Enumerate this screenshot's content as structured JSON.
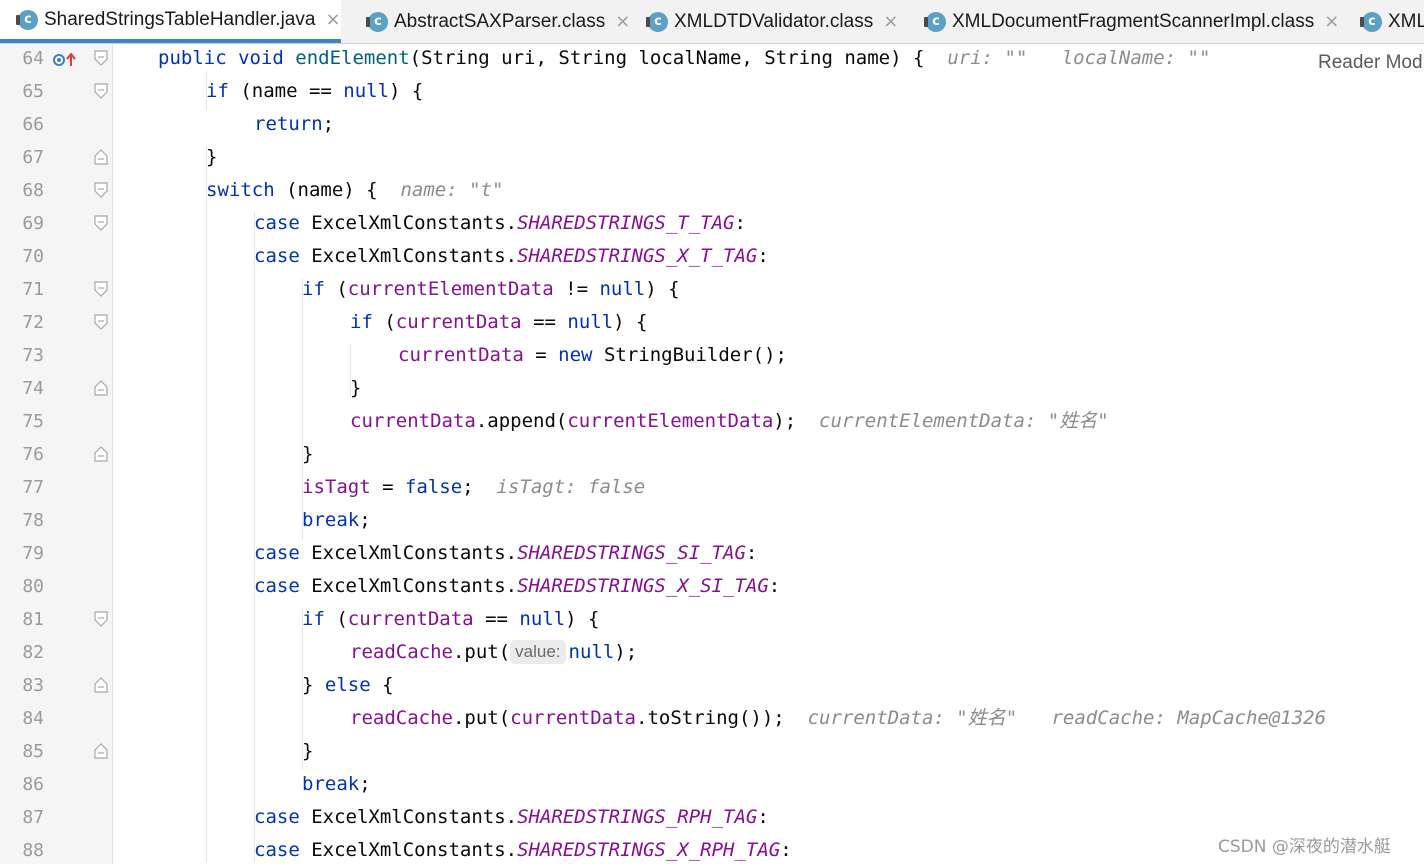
{
  "tabs": [
    {
      "label": "SharedStringsTableHandler.java",
      "active": true
    },
    {
      "label": "AbstractSAXParser.class",
      "active": false
    },
    {
      "label": "XMLDTDValidator.class",
      "active": false
    },
    {
      "label": "XMLDocumentFragmentScannerImpl.class",
      "active": false
    },
    {
      "label": "XML",
      "active": false
    }
  ],
  "icons": {
    "tab_icon": "class-c-icon",
    "close": "close-icon",
    "breakpoint": "override-up-arrow-icon",
    "fold": "fold-marker-icon"
  },
  "reader_mode": "Reader Mod",
  "watermark": "CSDN @深夜的潜水艇",
  "colors": {
    "keyword": "#0033b3",
    "field": "#871094",
    "method": "#00627a",
    "hint": "#8c8c8c",
    "tab_accent": "#4083c9"
  },
  "lines": [
    {
      "num": "64",
      "indent": 0,
      "segs": [
        [
          "kw",
          "public void "
        ],
        [
          "fn",
          "endElement"
        ],
        [
          "",
          "(String uri, String localName, String name) {  "
        ],
        [
          "hint",
          "uri: \"\"   localName: \"\""
        ]
      ]
    },
    {
      "num": "65",
      "indent": 1,
      "segs": [
        [
          "kw",
          "if"
        ],
        [
          "",
          " (name == "
        ],
        [
          "kw",
          "null"
        ],
        [
          "",
          ") {"
        ]
      ]
    },
    {
      "num": "66",
      "indent": 2,
      "segs": [
        [
          "kw",
          "return"
        ],
        [
          "",
          ";"
        ]
      ]
    },
    {
      "num": "67",
      "indent": 1,
      "segs": [
        [
          "",
          "}"
        ]
      ]
    },
    {
      "num": "68",
      "indent": 1,
      "segs": [
        [
          "kw",
          "switch"
        ],
        [
          "",
          " (name) {  "
        ],
        [
          "hint",
          "name: \"t\""
        ]
      ]
    },
    {
      "num": "69",
      "indent": 2,
      "segs": [
        [
          "kw",
          "case"
        ],
        [
          "",
          " ExcelXmlConstants."
        ],
        [
          "cst",
          "SHAREDSTRINGS_T_TAG"
        ],
        [
          "",
          ":"
        ]
      ]
    },
    {
      "num": "70",
      "indent": 2,
      "segs": [
        [
          "kw",
          "case"
        ],
        [
          "",
          " ExcelXmlConstants."
        ],
        [
          "cst",
          "SHAREDSTRINGS_X_T_TAG"
        ],
        [
          "",
          ":"
        ]
      ]
    },
    {
      "num": "71",
      "indent": 3,
      "segs": [
        [
          "kw",
          "if"
        ],
        [
          "",
          " ("
        ],
        [
          "fld",
          "currentElementData"
        ],
        [
          "",
          " != "
        ],
        [
          "kw",
          "null"
        ],
        [
          "",
          ") {"
        ]
      ]
    },
    {
      "num": "72",
      "indent": 4,
      "segs": [
        [
          "kw",
          "if"
        ],
        [
          "",
          " ("
        ],
        [
          "fld",
          "currentData"
        ],
        [
          "",
          " == "
        ],
        [
          "kw",
          "null"
        ],
        [
          "",
          ") {"
        ]
      ]
    },
    {
      "num": "73",
      "indent": 5,
      "segs": [
        [
          "fld",
          "currentData"
        ],
        [
          "",
          " = "
        ],
        [
          "kw",
          "new"
        ],
        [
          "",
          " StringBuilder();"
        ]
      ]
    },
    {
      "num": "74",
      "indent": 4,
      "segs": [
        [
          "",
          "}"
        ]
      ]
    },
    {
      "num": "75",
      "indent": 4,
      "segs": [
        [
          "fld",
          "currentData"
        ],
        [
          "",
          ".append("
        ],
        [
          "fld",
          "currentElementData"
        ],
        [
          "",
          ");  "
        ],
        [
          "hint",
          "currentElementData: \"姓名\""
        ]
      ]
    },
    {
      "num": "76",
      "indent": 3,
      "segs": [
        [
          "",
          "}"
        ]
      ]
    },
    {
      "num": "77",
      "indent": 3,
      "segs": [
        [
          "fld",
          "isTagt"
        ],
        [
          "",
          " = "
        ],
        [
          "kw",
          "false"
        ],
        [
          "",
          ";  "
        ],
        [
          "hint",
          "isTagt: false"
        ]
      ]
    },
    {
      "num": "78",
      "indent": 3,
      "segs": [
        [
          "kw",
          "break"
        ],
        [
          "",
          ";"
        ]
      ]
    },
    {
      "num": "79",
      "indent": 2,
      "segs": [
        [
          "kw",
          "case"
        ],
        [
          "",
          " ExcelXmlConstants."
        ],
        [
          "cst",
          "SHAREDSTRINGS_SI_TAG"
        ],
        [
          "",
          ":"
        ]
      ]
    },
    {
      "num": "80",
      "indent": 2,
      "segs": [
        [
          "kw",
          "case"
        ],
        [
          "",
          " ExcelXmlConstants."
        ],
        [
          "cst",
          "SHAREDSTRINGS_X_SI_TAG"
        ],
        [
          "",
          ":"
        ]
      ]
    },
    {
      "num": "81",
      "indent": 3,
      "segs": [
        [
          "kw",
          "if"
        ],
        [
          "",
          " ("
        ],
        [
          "fld",
          "currentData"
        ],
        [
          "",
          " == "
        ],
        [
          "kw",
          "null"
        ],
        [
          "",
          ") {"
        ]
      ]
    },
    {
      "num": "82",
      "indent": 4,
      "segs": [
        [
          "fld",
          "readCache"
        ],
        [
          "",
          ".put("
        ],
        [
          "phint",
          "value:"
        ],
        [
          "kw",
          "null"
        ],
        [
          "",
          ");"
        ]
      ]
    },
    {
      "num": "83",
      "indent": 3,
      "segs": [
        [
          "",
          "} "
        ],
        [
          "kw",
          "else"
        ],
        [
          "",
          " {"
        ]
      ]
    },
    {
      "num": "84",
      "indent": 4,
      "segs": [
        [
          "fld",
          "readCache"
        ],
        [
          "",
          ".put("
        ],
        [
          "fld",
          "currentData"
        ],
        [
          "",
          ".toString());  "
        ],
        [
          "hint",
          "currentData: \"姓名\"   readCache: MapCache@1326"
        ]
      ]
    },
    {
      "num": "85",
      "indent": 3,
      "segs": [
        [
          "",
          "}"
        ]
      ]
    },
    {
      "num": "86",
      "indent": 3,
      "segs": [
        [
          "kw",
          "break"
        ],
        [
          "",
          ";"
        ]
      ]
    },
    {
      "num": "87",
      "indent": 2,
      "segs": [
        [
          "kw",
          "case"
        ],
        [
          "",
          " ExcelXmlConstants."
        ],
        [
          "cst",
          "SHAREDSTRINGS_RPH_TAG"
        ],
        [
          "",
          ":"
        ]
      ]
    },
    {
      "num": "88",
      "indent": 2,
      "segs": [
        [
          "kw",
          "case"
        ],
        [
          "",
          " ExcelXmlConstants."
        ],
        [
          "cst",
          "SHAREDSTRINGS_X_RPH_TAG"
        ],
        [
          "",
          ":"
        ]
      ]
    }
  ]
}
